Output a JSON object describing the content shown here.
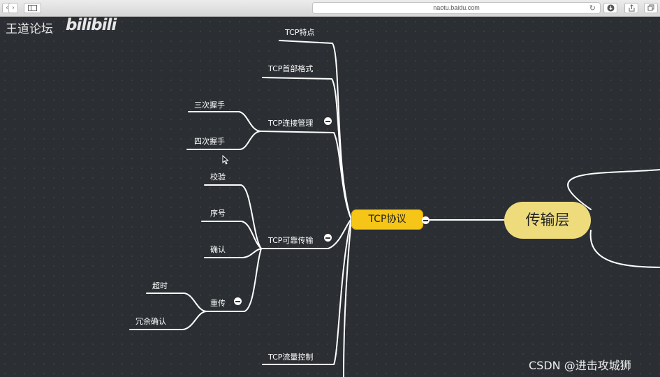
{
  "browser": {
    "url": "naotu.baidu.com",
    "back_icon": "chevron-left-icon",
    "forward_icon": "chevron-right-icon"
  },
  "watermark": {
    "site_name": "王道论坛",
    "bilibili": "bilibili"
  },
  "mindmap": {
    "root": "传输层",
    "main_topic": "TCP协议",
    "branches": {
      "features": "TCP特点",
      "header": "TCP首部格式",
      "connection": {
        "label": "TCP连接管理",
        "children": [
          "三次握手",
          "四次握手"
        ]
      },
      "reliable": {
        "label": "TCP可靠传输",
        "children": [
          "校验",
          "序号",
          "确认"
        ],
        "retransmit": {
          "label": "重传",
          "children": [
            "超时",
            "冗余确认"
          ]
        }
      },
      "flow_control": "TCP流量控制"
    }
  },
  "colors": {
    "background": "#2b2f33",
    "main_topic": "#f5c518",
    "root": "#eedc7c",
    "line": "#ffffff"
  },
  "credit": "CSDN @进击攻城狮"
}
